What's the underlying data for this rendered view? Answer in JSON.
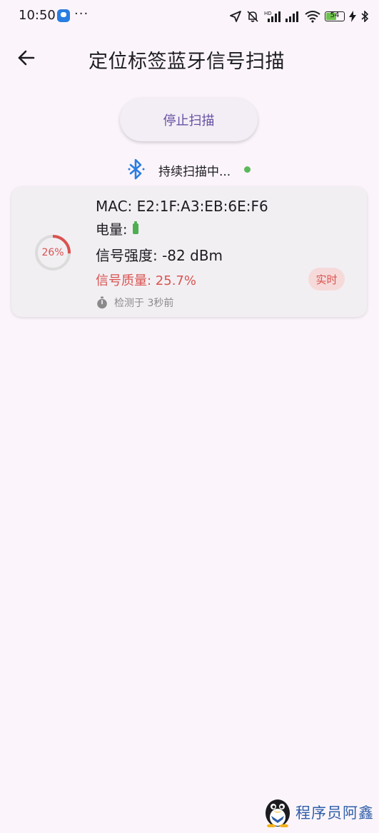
{
  "status_bar": {
    "time": "10:50",
    "more": "···",
    "network_badge": "HD",
    "battery_level": "54"
  },
  "app_bar": {
    "title": "定位标签蓝牙信号扫描",
    "back_icon": "arrow-left-icon"
  },
  "actions": {
    "stop_scan_label": "停止扫描"
  },
  "scan_status": {
    "text": "持续扫描中...",
    "indicator_color": "#5cb85c"
  },
  "devices": [
    {
      "mac": "MAC: E2:1F:A3:EB:6E:F6",
      "battery_label": "电量:",
      "rssi": "信号强度: -82 dBm",
      "quality": "信号质量: 25.7%",
      "gauge_label": "26%",
      "gauge_value": 0.257,
      "badge": "实时",
      "detected": "检测于 3秒前"
    }
  ],
  "watermark": {
    "text": "程序员阿鑫"
  },
  "colors": {
    "accent": "#6650a4",
    "danger": "#d9534f",
    "success": "#5cb85c",
    "background": "#fbf5fb"
  }
}
